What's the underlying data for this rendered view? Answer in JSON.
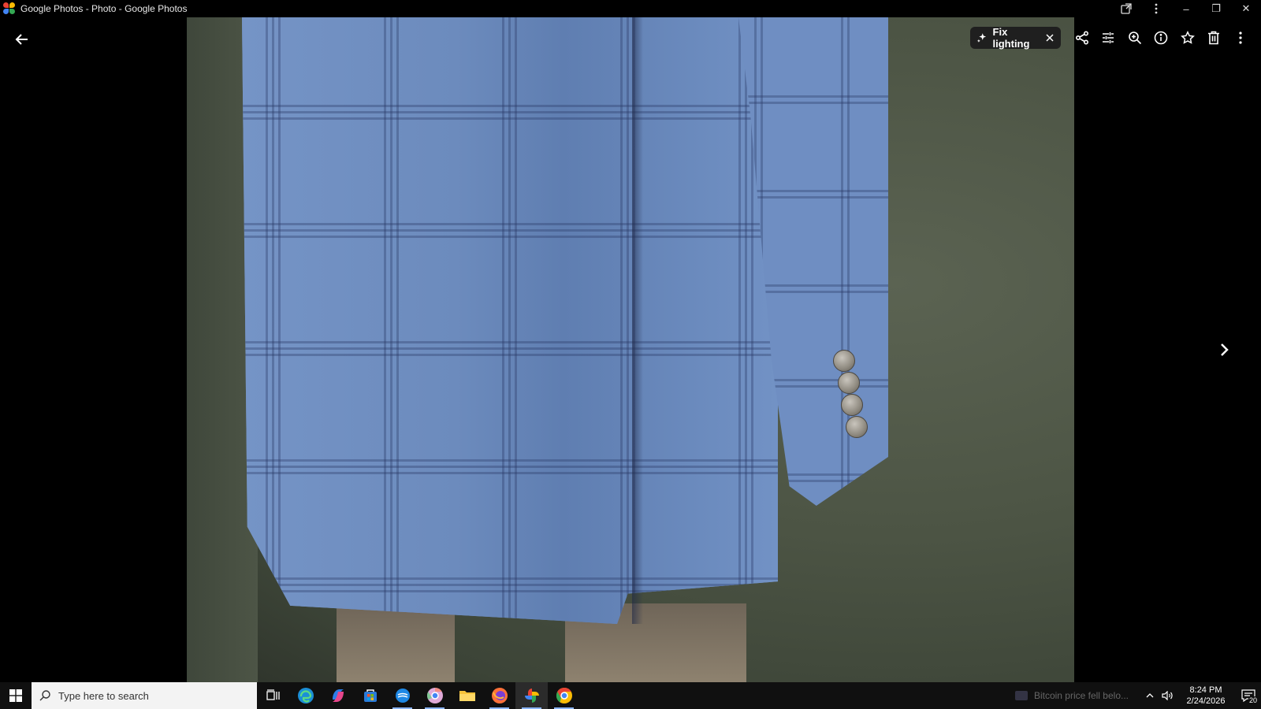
{
  "window": {
    "title": "Google Photos - Photo - Google Photos",
    "controls": {
      "open_external": "open-in-new-icon",
      "more": "more-vertical-icon",
      "minimize": "–",
      "restore": "❐",
      "close": "✕"
    }
  },
  "viewer": {
    "back_icon": "arrow-left-icon",
    "next_icon": "chevron-right-icon",
    "fix_lighting": {
      "label": "Fix lighting"
    },
    "toolbar": [
      "share-icon",
      "edit-adjust-icon",
      "zoom-in-icon",
      "info-icon",
      "favorite-star-icon",
      "delete-icon",
      "more-vertical-icon"
    ]
  },
  "taskbar": {
    "search_placeholder": "Type here to search",
    "apps": [
      "task-view",
      "edge",
      "copilot",
      "microsoft-store",
      "app-blue",
      "chrome-variant",
      "file-explorer",
      "firefox",
      "google-photos",
      "chrome"
    ],
    "news": "Bitcoin price fell belo...",
    "time": "8:24 PM",
    "date": "2/24/2026",
    "notifications": "20"
  },
  "colors": {
    "background": "#000000",
    "taskbar": "#101010",
    "accent": "#8ab4f8"
  }
}
